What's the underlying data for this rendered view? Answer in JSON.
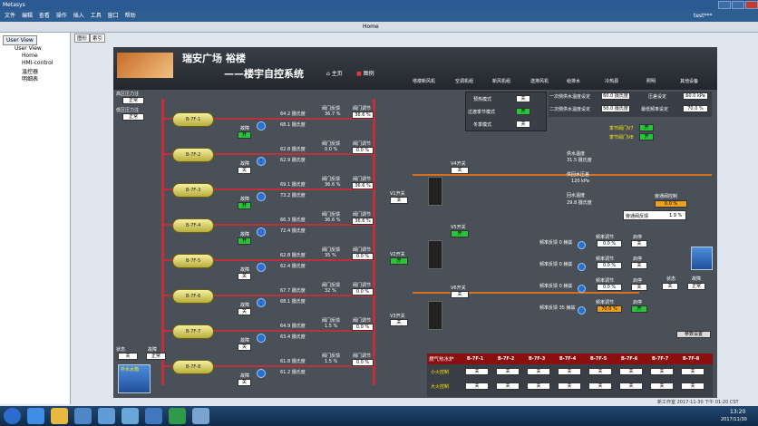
{
  "window": {
    "title": "Metasys",
    "user": "test***"
  },
  "menu": [
    "文件",
    "编辑",
    "查看",
    "操作",
    "插入",
    "工具",
    "窗口",
    "帮助"
  ],
  "toolbar": {
    "title": "Home"
  },
  "tree": {
    "tab": "User View",
    "nodes": [
      "User View",
      "Home",
      "HMI-control",
      "温控器",
      "明细表"
    ]
  },
  "tabs": [
    "图形",
    "索引"
  ],
  "banner": {
    "title1": "瑞安广场 裕楼",
    "title2": "——楼宇自控系统",
    "home": "主页",
    "legend": "图例",
    "nav": [
      "塔楼新风机",
      "空调机组",
      "新风机组",
      "送排风机",
      "给排水",
      "冷热源",
      "照明",
      "其他设备"
    ]
  },
  "pressure": {
    "high_label": "高区压力注",
    "high_val": "正常",
    "low_label": "低区压力注",
    "low_val": "正常"
  },
  "modes": [
    {
      "label": "预热模式",
      "val": "关"
    },
    {
      "label": "过渡季节模式",
      "val": "开"
    },
    {
      "label": "冬季模式",
      "val": "关"
    }
  ],
  "setpoints": [
    {
      "label": "一次侧供水温度设定",
      "val": "60.0 摄氏度"
    },
    {
      "label": "二次侧供水温度设定",
      "val": "50.0 摄氏度"
    },
    {
      "label": "压差设定",
      "val": "60.0 kPa"
    },
    {
      "label": "最低频率设定",
      "val": "70.0 %"
    }
  ],
  "boilers": [
    {
      "id": "B-7F-1",
      "temp1": "64.2 摄氏度",
      "temp2": "68.1 摄氏度",
      "fb": "36.7 %",
      "valve": "36.6 %",
      "pump": "开"
    },
    {
      "id": "B-7F-2",
      "temp1": "62.8 摄氏度",
      "temp2": "62.9 摄氏度",
      "fb": "0.0 %",
      "valve": "0.0 %",
      "pump": "关"
    },
    {
      "id": "B-7F-3",
      "temp1": "69.1 摄氏度",
      "temp2": "73.2 摄氏度",
      "fb": "36.6 %",
      "valve": "36.6 %",
      "pump": "开"
    },
    {
      "id": "B-7F-4",
      "temp1": "66.3 摄氏度",
      "temp2": "72.4 摄氏度",
      "fb": "36.6 %",
      "valve": "36.6 %",
      "pump": "开"
    },
    {
      "id": "B-7F-5",
      "temp1": "62.8 摄氏度",
      "temp2": "62.4 摄氏度",
      "fb": "35 %",
      "valve": "0.0 %",
      "pump": "关"
    },
    {
      "id": "B-7F-6",
      "temp1": "67.7 摄氏度",
      "temp2": "68.1 摄氏度",
      "fb": "32 %",
      "valve": "0.0 %",
      "pump": "关"
    },
    {
      "id": "B-7F-7",
      "temp1": "64.9 摄氏度",
      "temp2": "63.4 摄氏度",
      "fb": "1.5 %",
      "valve": "0.0 %",
      "pump": "关"
    },
    {
      "id": "B-7F-8",
      "temp1": "61.8 摄氏度",
      "temp2": "61.2 摄氏度",
      "fb": "1.5 %",
      "valve": "0.0 %",
      "pump": "关"
    }
  ],
  "labels": {
    "pump": "故障",
    "valve_fb": "阀门反馈",
    "valve_set": "阀门调节",
    "state": "状态",
    "fault": "故障",
    "more": "参数设置",
    "makeup": "补水水箱"
  },
  "state_block": {
    "state": "关",
    "fault": "正常"
  },
  "valves": [
    {
      "label": "V4开关",
      "val": "关"
    },
    {
      "label": "V5开关",
      "val": "开"
    },
    {
      "label": "V6开关",
      "val": "关"
    },
    {
      "label": "V1开关",
      "val": "关"
    },
    {
      "label": "V2开关",
      "val": "开"
    },
    {
      "label": "V3开关",
      "val": "关"
    }
  ],
  "supply": {
    "label1": "供水温度",
    "val1": "31.5 摄氏度",
    "label2": "供回水压差",
    "val2": "120 kPa",
    "label3": "回水温度",
    "val3": "29.8 摄氏度"
  },
  "bypass": {
    "label": "旁通阀控制",
    "val": "0.0 %",
    "fb_label": "旁通阀反馈",
    "fb_val": "1.9 %"
  },
  "season": {
    "a_label": "季节阀门V7",
    "a_val": "开",
    "b_label": "季节阀门V8",
    "b_val": "开"
  },
  "vfd": [
    {
      "fb": "频率反馈 0 赫兹",
      "set": "频率调节",
      "setv": "0.0 %",
      "pump": "启停",
      "pumpv": "关"
    },
    {
      "fb": "频率反馈 0 赫兹",
      "set": "频率调节",
      "setv": "0.0 %",
      "pump": "启停",
      "pumpv": "关"
    },
    {
      "fb": "频率反馈 0 赫兹",
      "set": "频率调节",
      "setv": "0.0 %",
      "pump": "启停",
      "pumpv": "关"
    },
    {
      "fb": "频率反馈 35 赫兹",
      "set": "频率调节",
      "setv": "70.0 %",
      "pump": "启停",
      "pumpv": "开"
    }
  ],
  "side_state": {
    "state": "状态",
    "stateval": "关",
    "fault": "故障",
    "faultval": "正常"
  },
  "table": {
    "header": "燃气热水炉",
    "cols": [
      "B-7F-1",
      "B-7F-2",
      "B-7F-3",
      "B-7F-4",
      "B-7F-5",
      "B-7F-6",
      "B-7F-7",
      "B-7F-8"
    ],
    "rows": [
      {
        "label": "小火控制",
        "vals": [
          "关",
          "关",
          "关",
          "关",
          "关",
          "关",
          "关",
          "关"
        ]
      },
      {
        "label": "大火控制",
        "vals": [
          "关",
          "关",
          "关",
          "关",
          "关",
          "关",
          "关",
          "关"
        ]
      }
    ]
  },
  "status_bar": {
    "text": "新工作室",
    "date": "2017-11-30 下午 01:20 CST"
  },
  "clock": {
    "time": "13:20",
    "date": "2017/11/30"
  }
}
